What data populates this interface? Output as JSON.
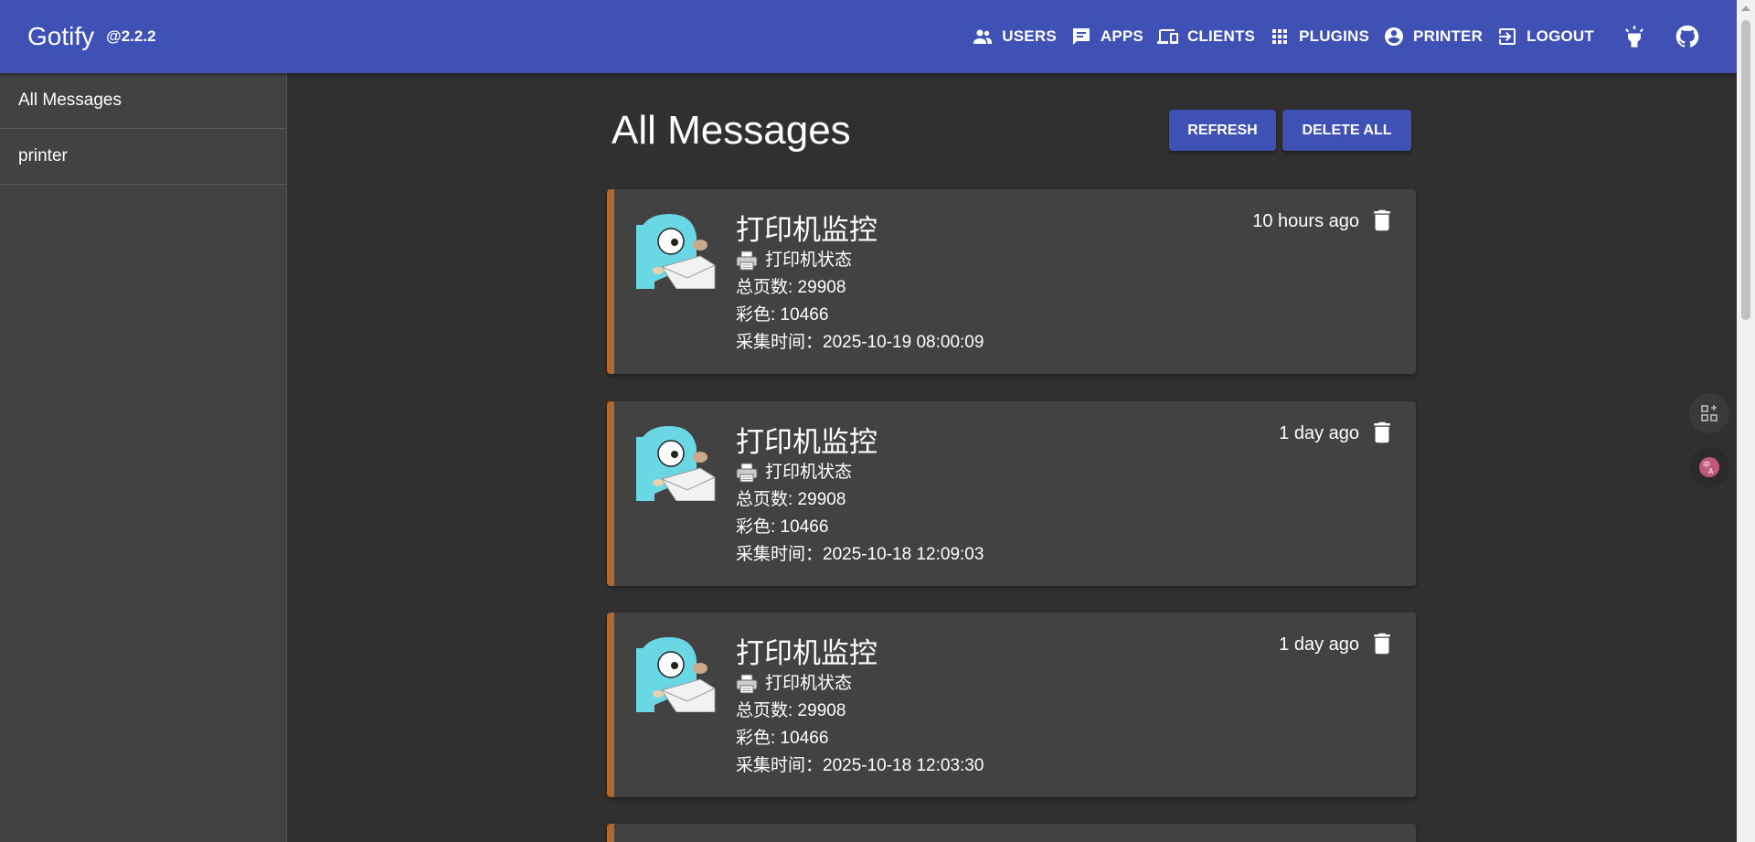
{
  "header": {
    "brand": "Gotify",
    "version": "@2.2.2",
    "nav": [
      {
        "label": "USERS",
        "icon": "users-icon"
      },
      {
        "label": "APPS",
        "icon": "chat-icon"
      },
      {
        "label": "CLIENTS",
        "icon": "devices-icon"
      },
      {
        "label": "PLUGINS",
        "icon": "apps-grid-icon"
      },
      {
        "label": "PRINTER",
        "icon": "account-circle-icon"
      },
      {
        "label": "LOGOUT",
        "icon": "logout-icon"
      }
    ],
    "theme_icon": "highlight-icon",
    "github_icon": "github-icon"
  },
  "sidebar": {
    "items": [
      {
        "label": "All Messages"
      },
      {
        "label": "printer"
      }
    ]
  },
  "main": {
    "title": "All Messages",
    "refresh_label": "REFRESH",
    "delete_all_label": "DELETE ALL",
    "messages": [
      {
        "title": "打印机监控",
        "time": "10 hours ago",
        "status": "打印机状态",
        "total": "总页数: 29908",
        "color": "彩色: 10466",
        "collected": "采集时间：2025-10-19 08:00:09"
      },
      {
        "title": "打印机监控",
        "time": "1 day ago",
        "status": "打印机状态",
        "total": "总页数: 29908",
        "color": "彩色: 10466",
        "collected": "采集时间：2025-10-18 12:09:03"
      },
      {
        "title": "打印机监控",
        "time": "1 day ago",
        "status": "打印机状态",
        "total": "总页数: 29908",
        "color": "彩色: 10466",
        "collected": "采集时间：2025-10-18 12:03:30"
      }
    ]
  },
  "colors": {
    "primary": "#3f51b5",
    "background": "#303030",
    "card": "#424242",
    "accent_border": "#b3672a"
  }
}
